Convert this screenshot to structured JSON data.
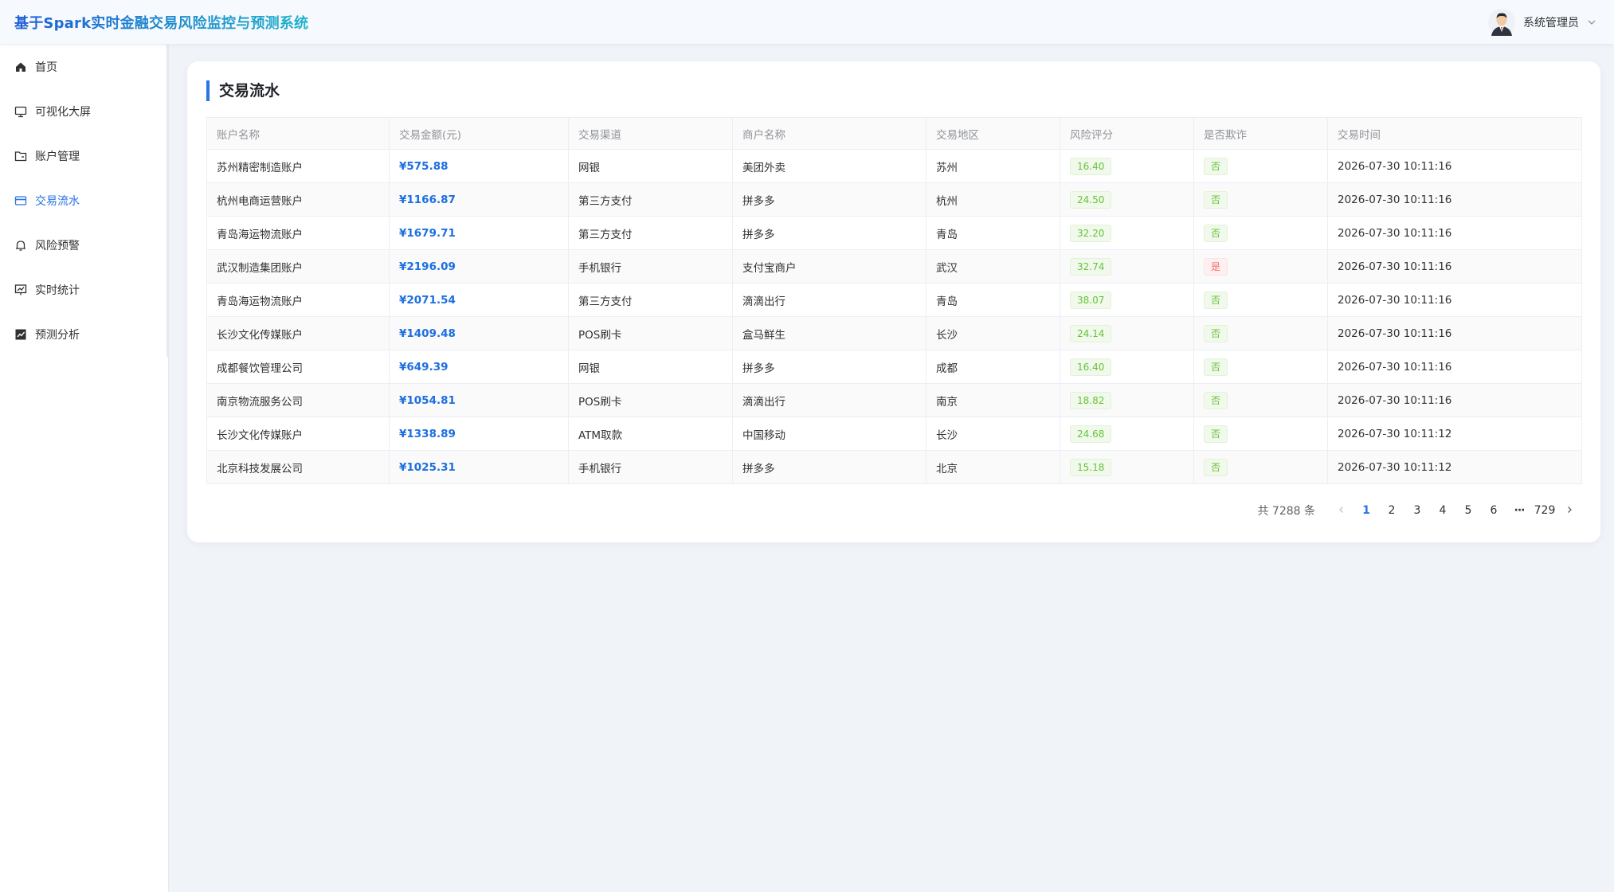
{
  "header": {
    "app_title": "基于Spark实时金融交易风险监控与预测系统",
    "user_name": "系统管理员"
  },
  "sidebar": {
    "items": [
      {
        "label": "首页",
        "icon": "home-icon"
      },
      {
        "label": "可视化大屏",
        "icon": "monitor-icon"
      },
      {
        "label": "账户管理",
        "icon": "folder-icon"
      },
      {
        "label": "交易流水",
        "icon": "card-icon",
        "active": true
      },
      {
        "label": "风险预警",
        "icon": "bell-icon"
      },
      {
        "label": "实时统计",
        "icon": "chart-board-icon"
      },
      {
        "label": "预测分析",
        "icon": "trend-chart-icon"
      }
    ]
  },
  "page": {
    "title": "交易流水"
  },
  "table": {
    "columns": [
      "账户名称",
      "交易金额(元)",
      "交易渠道",
      "商户名称",
      "交易地区",
      "风险评分",
      "是否欺诈",
      "交易时间"
    ],
    "rows": [
      {
        "account": "苏州精密制造账户",
        "amount": "¥575.88",
        "channel": "网银",
        "merchant": "美团外卖",
        "region": "苏州",
        "score": "16.40",
        "fraud": "否",
        "time": "2026-07-30 10:11:16"
      },
      {
        "account": "杭州电商运营账户",
        "amount": "¥1166.87",
        "channel": "第三方支付",
        "merchant": "拼多多",
        "region": "杭州",
        "score": "24.50",
        "fraud": "否",
        "time": "2026-07-30 10:11:16"
      },
      {
        "account": "青岛海运物流账户",
        "amount": "¥1679.71",
        "channel": "第三方支付",
        "merchant": "拼多多",
        "region": "青岛",
        "score": "32.20",
        "fraud": "否",
        "time": "2026-07-30 10:11:16"
      },
      {
        "account": "武汉制造集团账户",
        "amount": "¥2196.09",
        "channel": "手机银行",
        "merchant": "支付宝商户",
        "region": "武汉",
        "score": "32.74",
        "fraud": "是",
        "time": "2026-07-30 10:11:16"
      },
      {
        "account": "青岛海运物流账户",
        "amount": "¥2071.54",
        "channel": "第三方支付",
        "merchant": "滴滴出行",
        "region": "青岛",
        "score": "38.07",
        "fraud": "否",
        "time": "2026-07-30 10:11:16"
      },
      {
        "account": "长沙文化传媒账户",
        "amount": "¥1409.48",
        "channel": "POS刷卡",
        "merchant": "盒马鲜生",
        "region": "长沙",
        "score": "24.14",
        "fraud": "否",
        "time": "2026-07-30 10:11:16"
      },
      {
        "account": "成都餐饮管理公司",
        "amount": "¥649.39",
        "channel": "网银",
        "merchant": "拼多多",
        "region": "成都",
        "score": "16.40",
        "fraud": "否",
        "time": "2026-07-30 10:11:16"
      },
      {
        "account": "南京物流服务公司",
        "amount": "¥1054.81",
        "channel": "POS刷卡",
        "merchant": "滴滴出行",
        "region": "南京",
        "score": "18.82",
        "fraud": "否",
        "time": "2026-07-30 10:11:16"
      },
      {
        "account": "长沙文化传媒账户",
        "amount": "¥1338.89",
        "channel": "ATM取款",
        "merchant": "中国移动",
        "region": "长沙",
        "score": "24.68",
        "fraud": "否",
        "time": "2026-07-30 10:11:12"
      },
      {
        "account": "北京科技发展公司",
        "amount": "¥1025.31",
        "channel": "手机银行",
        "merchant": "拼多多",
        "region": "北京",
        "score": "15.18",
        "fraud": "否",
        "time": "2026-07-30 10:11:12"
      }
    ]
  },
  "pagination": {
    "total": "共 7288 条",
    "pages": [
      "1",
      "2",
      "3",
      "4",
      "5",
      "6"
    ],
    "ellipsis": "···",
    "last_page": "729",
    "current": "1"
  },
  "colors": {
    "accent": "#2b74e6",
    "amount": "#1d6fe0",
    "tag_green": "#67c23a",
    "tag_red": "#f56c6c",
    "page_bg": "#f0f3f8"
  }
}
